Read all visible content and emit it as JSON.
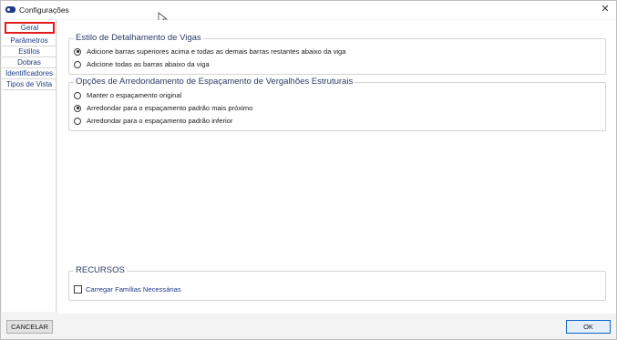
{
  "window": {
    "title": "Configurações",
    "close_symbol": "✕"
  },
  "sidebar": {
    "items": [
      {
        "label": "Geral",
        "active": true
      },
      {
        "label": "Parâmetros",
        "active": false
      },
      {
        "label": "Estilos",
        "active": false
      },
      {
        "label": "Dobras",
        "active": false
      },
      {
        "label": "Identificadores",
        "active": false
      },
      {
        "label": "Tipos de Vista",
        "active": false
      }
    ]
  },
  "groups": {
    "beam_detail": {
      "title": "Estilo de Detalhamento de Vigas",
      "options": [
        {
          "label": "Adicione barras superiores acima e todas as demais barras restantes abaixo da viga",
          "checked": true
        },
        {
          "label": "Adicione todas as barras abaixo da viga",
          "checked": false
        }
      ]
    },
    "rounding": {
      "title": "Opções de Arredondamento de Espaçamento de Vergalhões Estruturais",
      "options": [
        {
          "label": "Manter o espaçamento original",
          "checked": false
        },
        {
          "label": "Arredondar para o espaçamento padrão mais próximo",
          "checked": true
        },
        {
          "label": "Arredondar para o espaçamento padrão inferior",
          "checked": false
        }
      ]
    },
    "resources": {
      "title": "RECURSOS",
      "checkbox_label": "Carregar Famílias Necessárias",
      "checked": false
    }
  },
  "footer": {
    "cancel_label": "CANCELAR",
    "ok_label": "OK"
  },
  "colors": {
    "active_border": "#e21b1b",
    "link_blue": "#1f3c88",
    "primary_border": "#0a64c8"
  }
}
